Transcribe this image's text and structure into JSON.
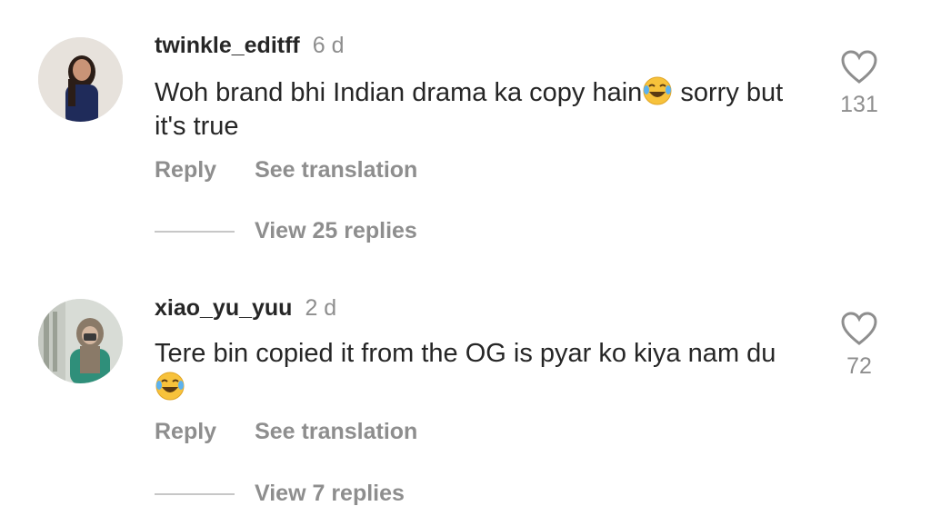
{
  "comments": [
    {
      "username": "twinkle_editff",
      "time": "6 d",
      "text_before_emoji": "Woh brand bhi Indian drama ka copy hain",
      "emoji": "face-with-tears-of-joy-icon",
      "text_after_emoji": " sorry but it's true",
      "reply_label": "Reply",
      "translate_label": "See translation",
      "view_replies_label": "View 25 replies",
      "like_count": "131"
    },
    {
      "username": "xiao_yu_yuu",
      "time": "2 d",
      "text_before_emoji": "Tere bin copied it from the OG is pyar ko kiya nam du ",
      "emoji": "face-with-tears-of-joy-icon",
      "text_after_emoji": "",
      "reply_label": "Reply",
      "translate_label": "See translation",
      "view_replies_label": "View 7 replies",
      "like_count": "72"
    }
  ],
  "colors": {
    "primary_text": "#262626",
    "secondary_text": "#8e8e8e",
    "divider": "#c7c7c7",
    "background": "#ffffff"
  }
}
